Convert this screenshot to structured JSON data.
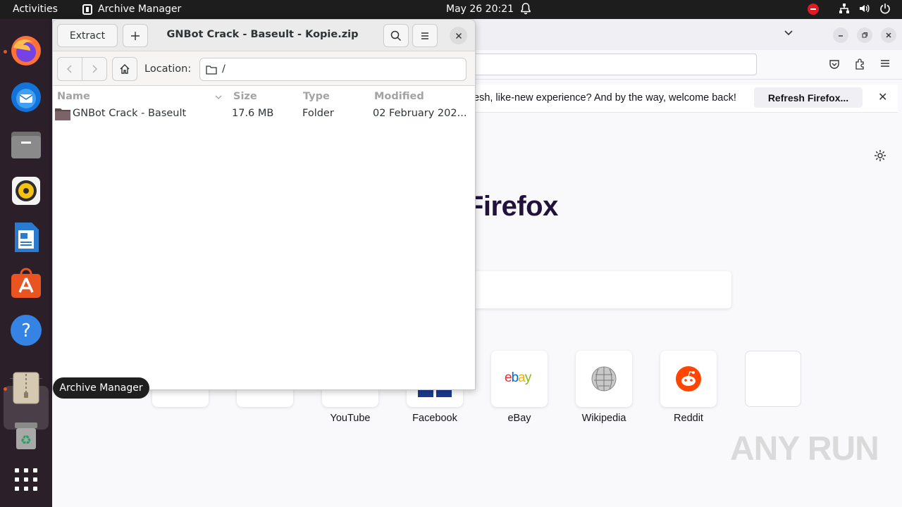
{
  "topbar": {
    "activities": "Activities",
    "app_name": "Archive Manager",
    "clock": "May 26  20:21",
    "icons": [
      "bell-icon",
      "do-not-disturb-icon",
      "network-icon",
      "volume-icon",
      "power-icon"
    ]
  },
  "dock": {
    "items": [
      "Firefox",
      "Thunderbird",
      "Files",
      "Rhythmbox",
      "LibreOffice Writer",
      "Ubuntu Software",
      "Help",
      "Archive Manager",
      "Trash",
      "Show Applications"
    ],
    "tooltip": "Archive Manager"
  },
  "firefox": {
    "notification_text": "esh, like-new experience? And by the way, welcome back!",
    "refresh_button": "Refresh Firefox...",
    "logo_text": "Firefox",
    "shortcuts": [
      "YouTube",
      "Facebook",
      "eBay",
      "Wikipedia",
      "Reddit"
    ],
    "ebay_logo": "ebay"
  },
  "archive_manager": {
    "extract_button": "Extract",
    "title": "GNBot Crack - Baseult - Kopie.zip",
    "location_label": "Location:",
    "location_value": "/",
    "columns": {
      "name": "Name",
      "size": "Size",
      "type": "Type",
      "modified": "Modified"
    },
    "rows": [
      {
        "name": "GNBot Crack - Baseult",
        "size": "17.6 MB",
        "type": "Folder",
        "modified": "02 February 202..."
      }
    ]
  },
  "watermark": "ANY RUN",
  "colors": {
    "accent_orange": "#e95420",
    "dnd_red": "#e01b24",
    "dock_bg": "#2b1f2a"
  }
}
